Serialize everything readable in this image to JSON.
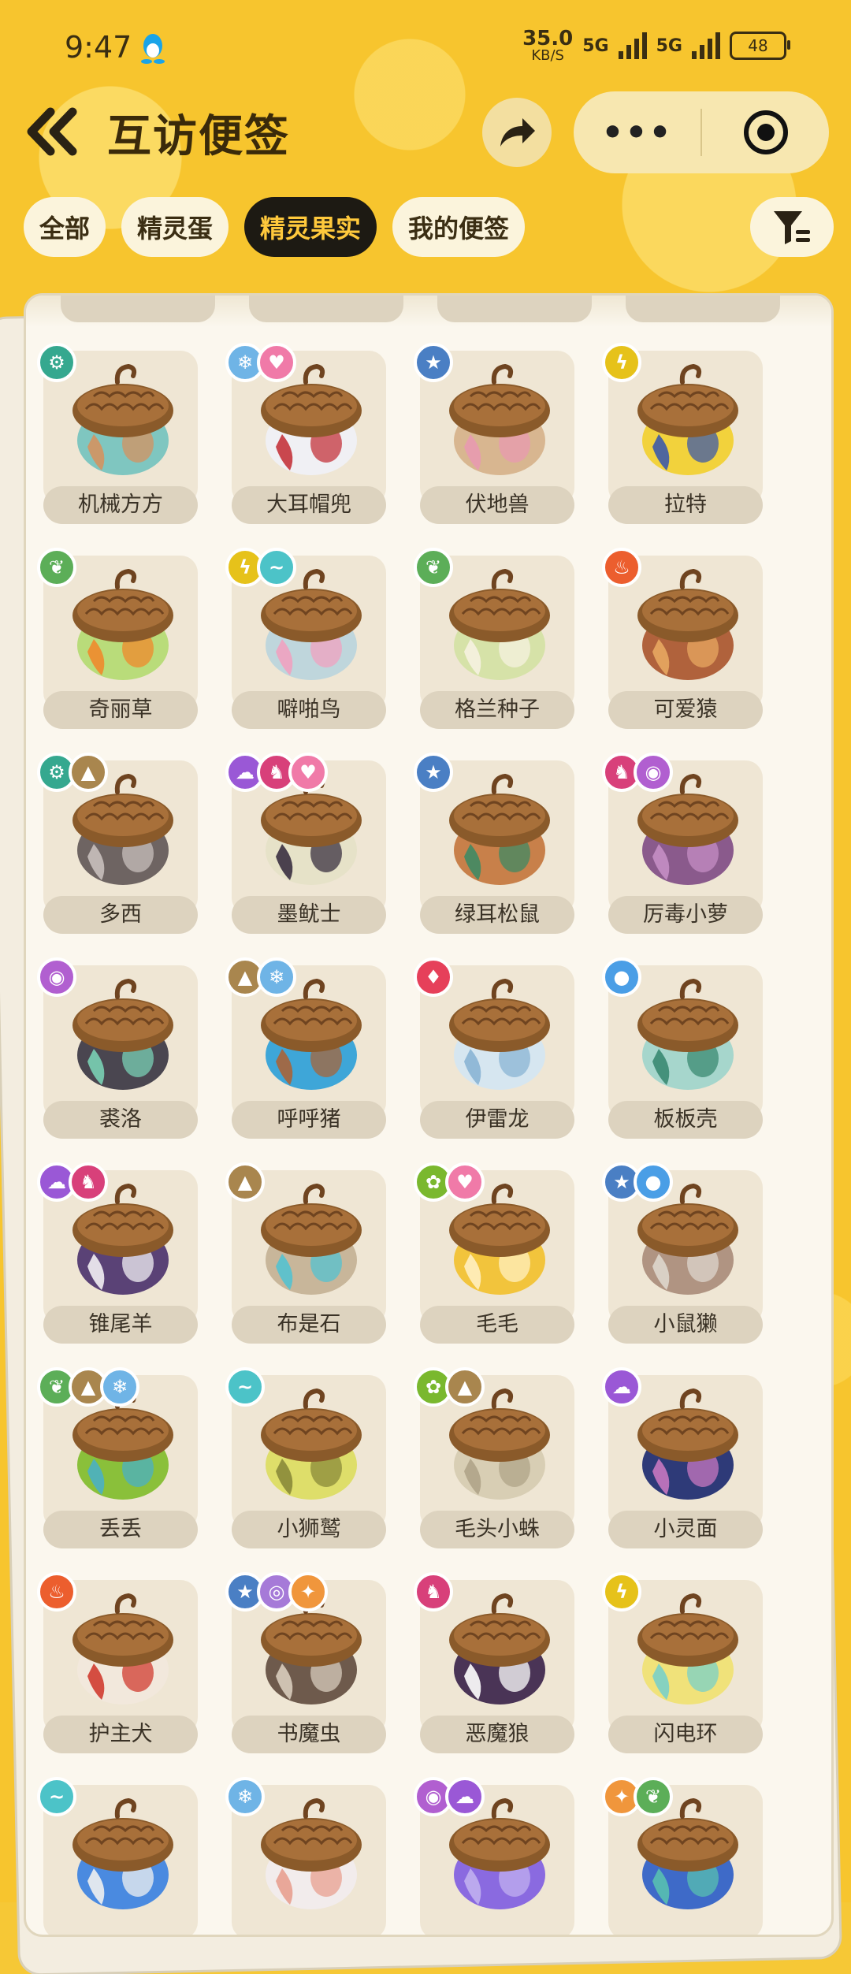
{
  "status": {
    "time": "9:47",
    "speed": "35.0",
    "speed_unit": "KB/S",
    "net1": "5G",
    "net2": "5G",
    "battery": "48"
  },
  "header": {
    "title": "互访便签",
    "more_glyph": "•••"
  },
  "tabs": [
    {
      "label": "全部",
      "active": false
    },
    {
      "label": "精灵蛋",
      "active": false
    },
    {
      "label": "精灵果实",
      "active": true
    },
    {
      "label": "我的便签",
      "active": false
    }
  ],
  "type_colors": {
    "mech": "#35a88f",
    "ice": "#6fb4e6",
    "cute": "#f07aa8",
    "star": "#4a7fc4",
    "electric": "#e6c21a",
    "grass": "#5cae58",
    "wing": "#4cc3c8",
    "fire": "#ec5e2e",
    "ground": "#a9864e",
    "ghost": "#9a58d6",
    "demon": "#d8407a",
    "poison": "#b15fd0",
    "dragon": "#e6405a",
    "water": "#4a9ee6",
    "bug": "#7ab82e",
    "psychic": "#a67ad8",
    "light": "#f0963c"
  },
  "type_glyphs": {
    "mech": "⚙",
    "ice": "❄",
    "cute": "♥",
    "star": "★",
    "electric": "ϟ",
    "grass": "❦",
    "wing": "~",
    "fire": "♨",
    "ground": "▲",
    "ghost": "☁",
    "demon": "♞",
    "poison": "◉",
    "dragon": "♦",
    "water": "●",
    "bug": "✿",
    "psychic": "◎",
    "light": "✦"
  },
  "fruits": [
    {
      "name": "机械方方",
      "types": [
        "mech"
      ],
      "colors": [
        "#7fc6c0",
        "#d49260"
      ]
    },
    {
      "name": "大耳帽兜",
      "types": [
        "ice",
        "cute"
      ],
      "colors": [
        "#f0f0f4",
        "#c4343c"
      ]
    },
    {
      "name": "伏地兽",
      "types": [
        "star"
      ],
      "colors": [
        "#d8b690",
        "#e89ab0"
      ]
    },
    {
      "name": "拉特",
      "types": [
        "electric"
      ],
      "colors": [
        "#f2d23c",
        "#3d5aa8"
      ]
    },
    {
      "name": "奇丽草",
      "types": [
        "grass"
      ],
      "colors": [
        "#b9dc7a",
        "#f08a2c"
      ]
    },
    {
      "name": "噼啪鸟",
      "types": [
        "electric",
        "wing"
      ],
      "colors": [
        "#bfd6dc",
        "#f0a2c0"
      ]
    },
    {
      "name": "格兰种子",
      "types": [
        "grass"
      ],
      "colors": [
        "#d6e2a8",
        "#f6f2e0"
      ]
    },
    {
      "name": "可爱猿",
      "types": [
        "fire"
      ],
      "colors": [
        "#b0623c",
        "#e8a860"
      ]
    },
    {
      "name": "多西",
      "types": [
        "mech",
        "ground"
      ],
      "colors": [
        "#6e6462",
        "#c8bfbc"
      ]
    },
    {
      "name": "墨鱿士",
      "types": [
        "ghost",
        "demon",
        "cute"
      ],
      "colors": [
        "#e6e2c8",
        "#3a3040"
      ]
    },
    {
      "name": "绿耳松鼠",
      "types": [
        "star"
      ],
      "colors": [
        "#c8804a",
        "#3f8a64"
      ]
    },
    {
      "name": "厉毒小萝",
      "types": [
        "demon",
        "poison"
      ],
      "colors": [
        "#8a5a8c",
        "#c48ec4"
      ]
    },
    {
      "name": "裘洛",
      "types": [
        "poison"
      ],
      "colors": [
        "#4a4650",
        "#7ad0b4"
      ]
    },
    {
      "name": "呼呼猪",
      "types": [
        "ground",
        "ice"
      ],
      "colors": [
        "#3ea6d8",
        "#a8643a"
      ]
    },
    {
      "name": "伊雷龙",
      "types": [
        "dragon"
      ],
      "colors": [
        "#d6e6f0",
        "#8ab4d4"
      ]
    },
    {
      "name": "板板壳",
      "types": [
        "water"
      ],
      "colors": [
        "#a6d6cc",
        "#3a8a72"
      ]
    },
    {
      "name": "锥尾羊",
      "types": [
        "ghost",
        "demon"
      ],
      "colors": [
        "#5a4276",
        "#f2f0f4"
      ]
    },
    {
      "name": "布是石",
      "types": [
        "ground"
      ],
      "colors": [
        "#c8b69a",
        "#54c2d0"
      ]
    },
    {
      "name": "毛毛",
      "types": [
        "bug",
        "cute"
      ],
      "colors": [
        "#f2c43c",
        "#fff0c0"
      ]
    },
    {
      "name": "小鼠獭",
      "types": [
        "star",
        "water"
      ],
      "colors": [
        "#b09482",
        "#ded6cc"
      ]
    },
    {
      "name": "丢丢",
      "types": [
        "grass",
        "ground",
        "ice"
      ],
      "colors": [
        "#8ac03a",
        "#4ab0c4"
      ]
    },
    {
      "name": "小狮鹫",
      "types": [
        "wing"
      ],
      "colors": [
        "#dede6a",
        "#8a8a3a"
      ]
    },
    {
      "name": "毛头小蛛",
      "types": [
        "bug",
        "ground"
      ],
      "colors": [
        "#d8ceb4",
        "#b0a488"
      ]
    },
    {
      "name": "小灵面",
      "types": [
        "ghost"
      ],
      "colors": [
        "#2e3a78",
        "#c878c0"
      ]
    },
    {
      "name": "护主犬",
      "types": [
        "fire"
      ],
      "colors": [
        "#f2e8dc",
        "#d03c30"
      ]
    },
    {
      "name": "书魔虫",
      "types": [
        "star",
        "psychic",
        "light"
      ],
      "colors": [
        "#6e5a4c",
        "#d8ccbc"
      ]
    },
    {
      "name": "恶魔狼",
      "types": [
        "demon"
      ],
      "colors": [
        "#4a3456",
        "#ffffff"
      ]
    },
    {
      "name": "闪电环",
      "types": [
        "electric"
      ],
      "colors": [
        "#f0e27a",
        "#7ad0c8"
      ]
    }
  ],
  "partial_row": [
    {
      "types": [
        "wing"
      ],
      "colors": [
        "#4a8ae0",
        "#f0f0f0"
      ]
    },
    {
      "types": [
        "ice"
      ],
      "colors": [
        "#f2ecec",
        "#e8a090"
      ]
    },
    {
      "types": [
        "poison",
        "ghost"
      ],
      "colors": [
        "#8a6ae0",
        "#c0b0f0"
      ]
    },
    {
      "types": [
        "light",
        "grass"
      ],
      "colors": [
        "#3e6ac8",
        "#58c0b0"
      ]
    }
  ]
}
